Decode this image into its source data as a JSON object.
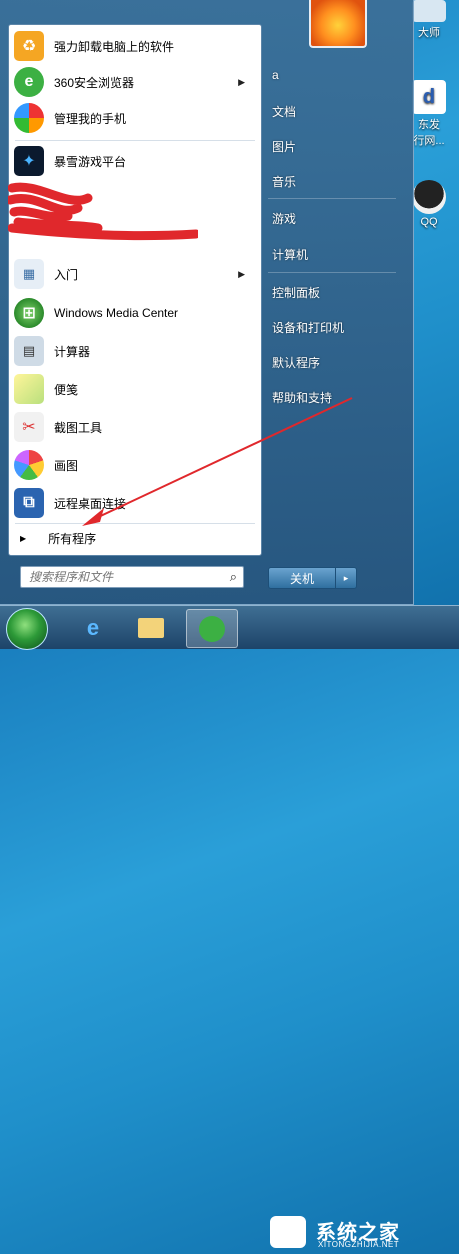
{
  "start_menu": {
    "programs": [
      {
        "label": "强力卸载电脑上的软件",
        "icon": "uninstall-icon",
        "has_arrow": false
      },
      {
        "label": "360安全浏览器",
        "icon": "browser-360-icon",
        "has_arrow": true
      },
      {
        "label": "管理我的手机",
        "icon": "phone-manager-icon",
        "has_arrow": false
      },
      {
        "label": "暴雪游戏平台",
        "icon": "battlenet-icon",
        "has_arrow": false
      },
      {
        "label": "入门",
        "icon": "getting-started-icon",
        "has_arrow": true
      },
      {
        "label": "Windows Media Center",
        "icon": "media-center-icon",
        "has_arrow": false
      },
      {
        "label": "计算器",
        "icon": "calculator-icon",
        "has_arrow": false
      },
      {
        "label": "便笺",
        "icon": "sticky-notes-icon",
        "has_arrow": false
      },
      {
        "label": "截图工具",
        "icon": "snipping-tool-icon",
        "has_arrow": false
      },
      {
        "label": "画图",
        "icon": "paint-icon",
        "has_arrow": false
      },
      {
        "label": "远程桌面连接",
        "icon": "remote-desktop-icon",
        "has_arrow": false
      }
    ],
    "all_programs_label": "所有程序",
    "search_placeholder": "搜索程序和文件",
    "right_items": [
      {
        "label": "a"
      },
      {
        "label": "文档"
      },
      {
        "label": "图片"
      },
      {
        "label": "音乐"
      },
      {
        "label": "游戏"
      },
      {
        "label": "计算机"
      },
      {
        "label": "控制面板"
      },
      {
        "label": "设备和打印机"
      },
      {
        "label": "默认程序"
      },
      {
        "label": "帮助和支持"
      }
    ],
    "shutdown_label": "关机",
    "shutdown_arrow": "▸"
  },
  "desktop": {
    "icons": [
      {
        "label": "大师"
      },
      {
        "label": "东发"
      },
      {
        "label": "行网..."
      },
      {
        "label": "QQ"
      }
    ]
  },
  "watermark": {
    "title": "系统之家",
    "url": "XITONGZHIJIA.NET"
  },
  "colors": {
    "annotation_red": "#e0282c",
    "accent": "#2a9fd8"
  }
}
